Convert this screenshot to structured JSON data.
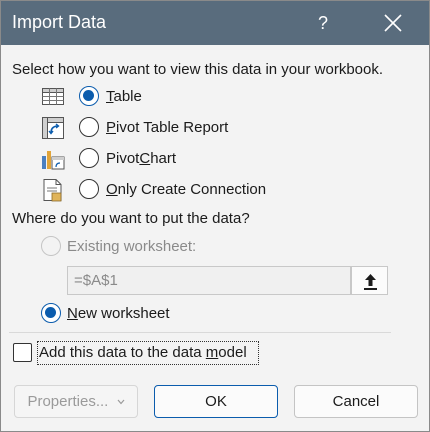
{
  "window": {
    "title": "Import Data",
    "help_label": "?"
  },
  "view": {
    "heading": "Select how you want to view this data in your workbook.",
    "options": [
      {
        "label_prefix": "",
        "label_access": "T",
        "label_rest": "able",
        "selected": true
      },
      {
        "label_prefix": "",
        "label_access": "P",
        "label_rest": "ivot Table Report",
        "selected": false
      },
      {
        "label_prefix": "Pivot",
        "label_access": "C",
        "label_rest": "hart",
        "selected": false
      },
      {
        "label_prefix": "",
        "label_access": "O",
        "label_rest": "nly Create Connection",
        "selected": false
      }
    ]
  },
  "location": {
    "heading": "Where do you want to put the data?",
    "existing_label": "Existing worksheet:",
    "existing_ref": "=$A$1",
    "new_label_access": "N",
    "new_label_rest": "ew worksheet",
    "new_selected": true
  },
  "model": {
    "label_prefix": "Add this data to the data ",
    "label_access": "m",
    "label_rest": "odel",
    "checked": false
  },
  "buttons": {
    "properties": "Properties...",
    "ok": "OK",
    "cancel": "Cancel"
  },
  "colors": {
    "titlebar": "#596c7d",
    "accent": "#0b5cad"
  }
}
